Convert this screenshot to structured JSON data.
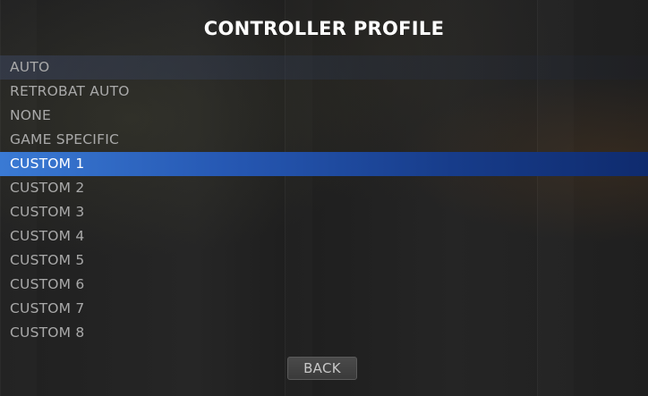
{
  "dialog": {
    "title": "CONTROLLER PROFILE",
    "options": [
      "AUTO",
      "RETROBAT AUTO",
      "NONE",
      "GAME SPECIFIC",
      "CUSTOM 1",
      "CUSTOM 2",
      "CUSTOM 3",
      "CUSTOM 4",
      "CUSTOM 5",
      "CUSTOM 6",
      "CUSTOM 7",
      "CUSTOM 8"
    ],
    "selected_option": "CUSTOM 1",
    "back_label": "BACK"
  },
  "colors": {
    "selection_start": "#3a7ad4",
    "selection_end": "#0f2b6e",
    "option_text": "#a9a9a9",
    "selected_text": "#ffffff"
  }
}
